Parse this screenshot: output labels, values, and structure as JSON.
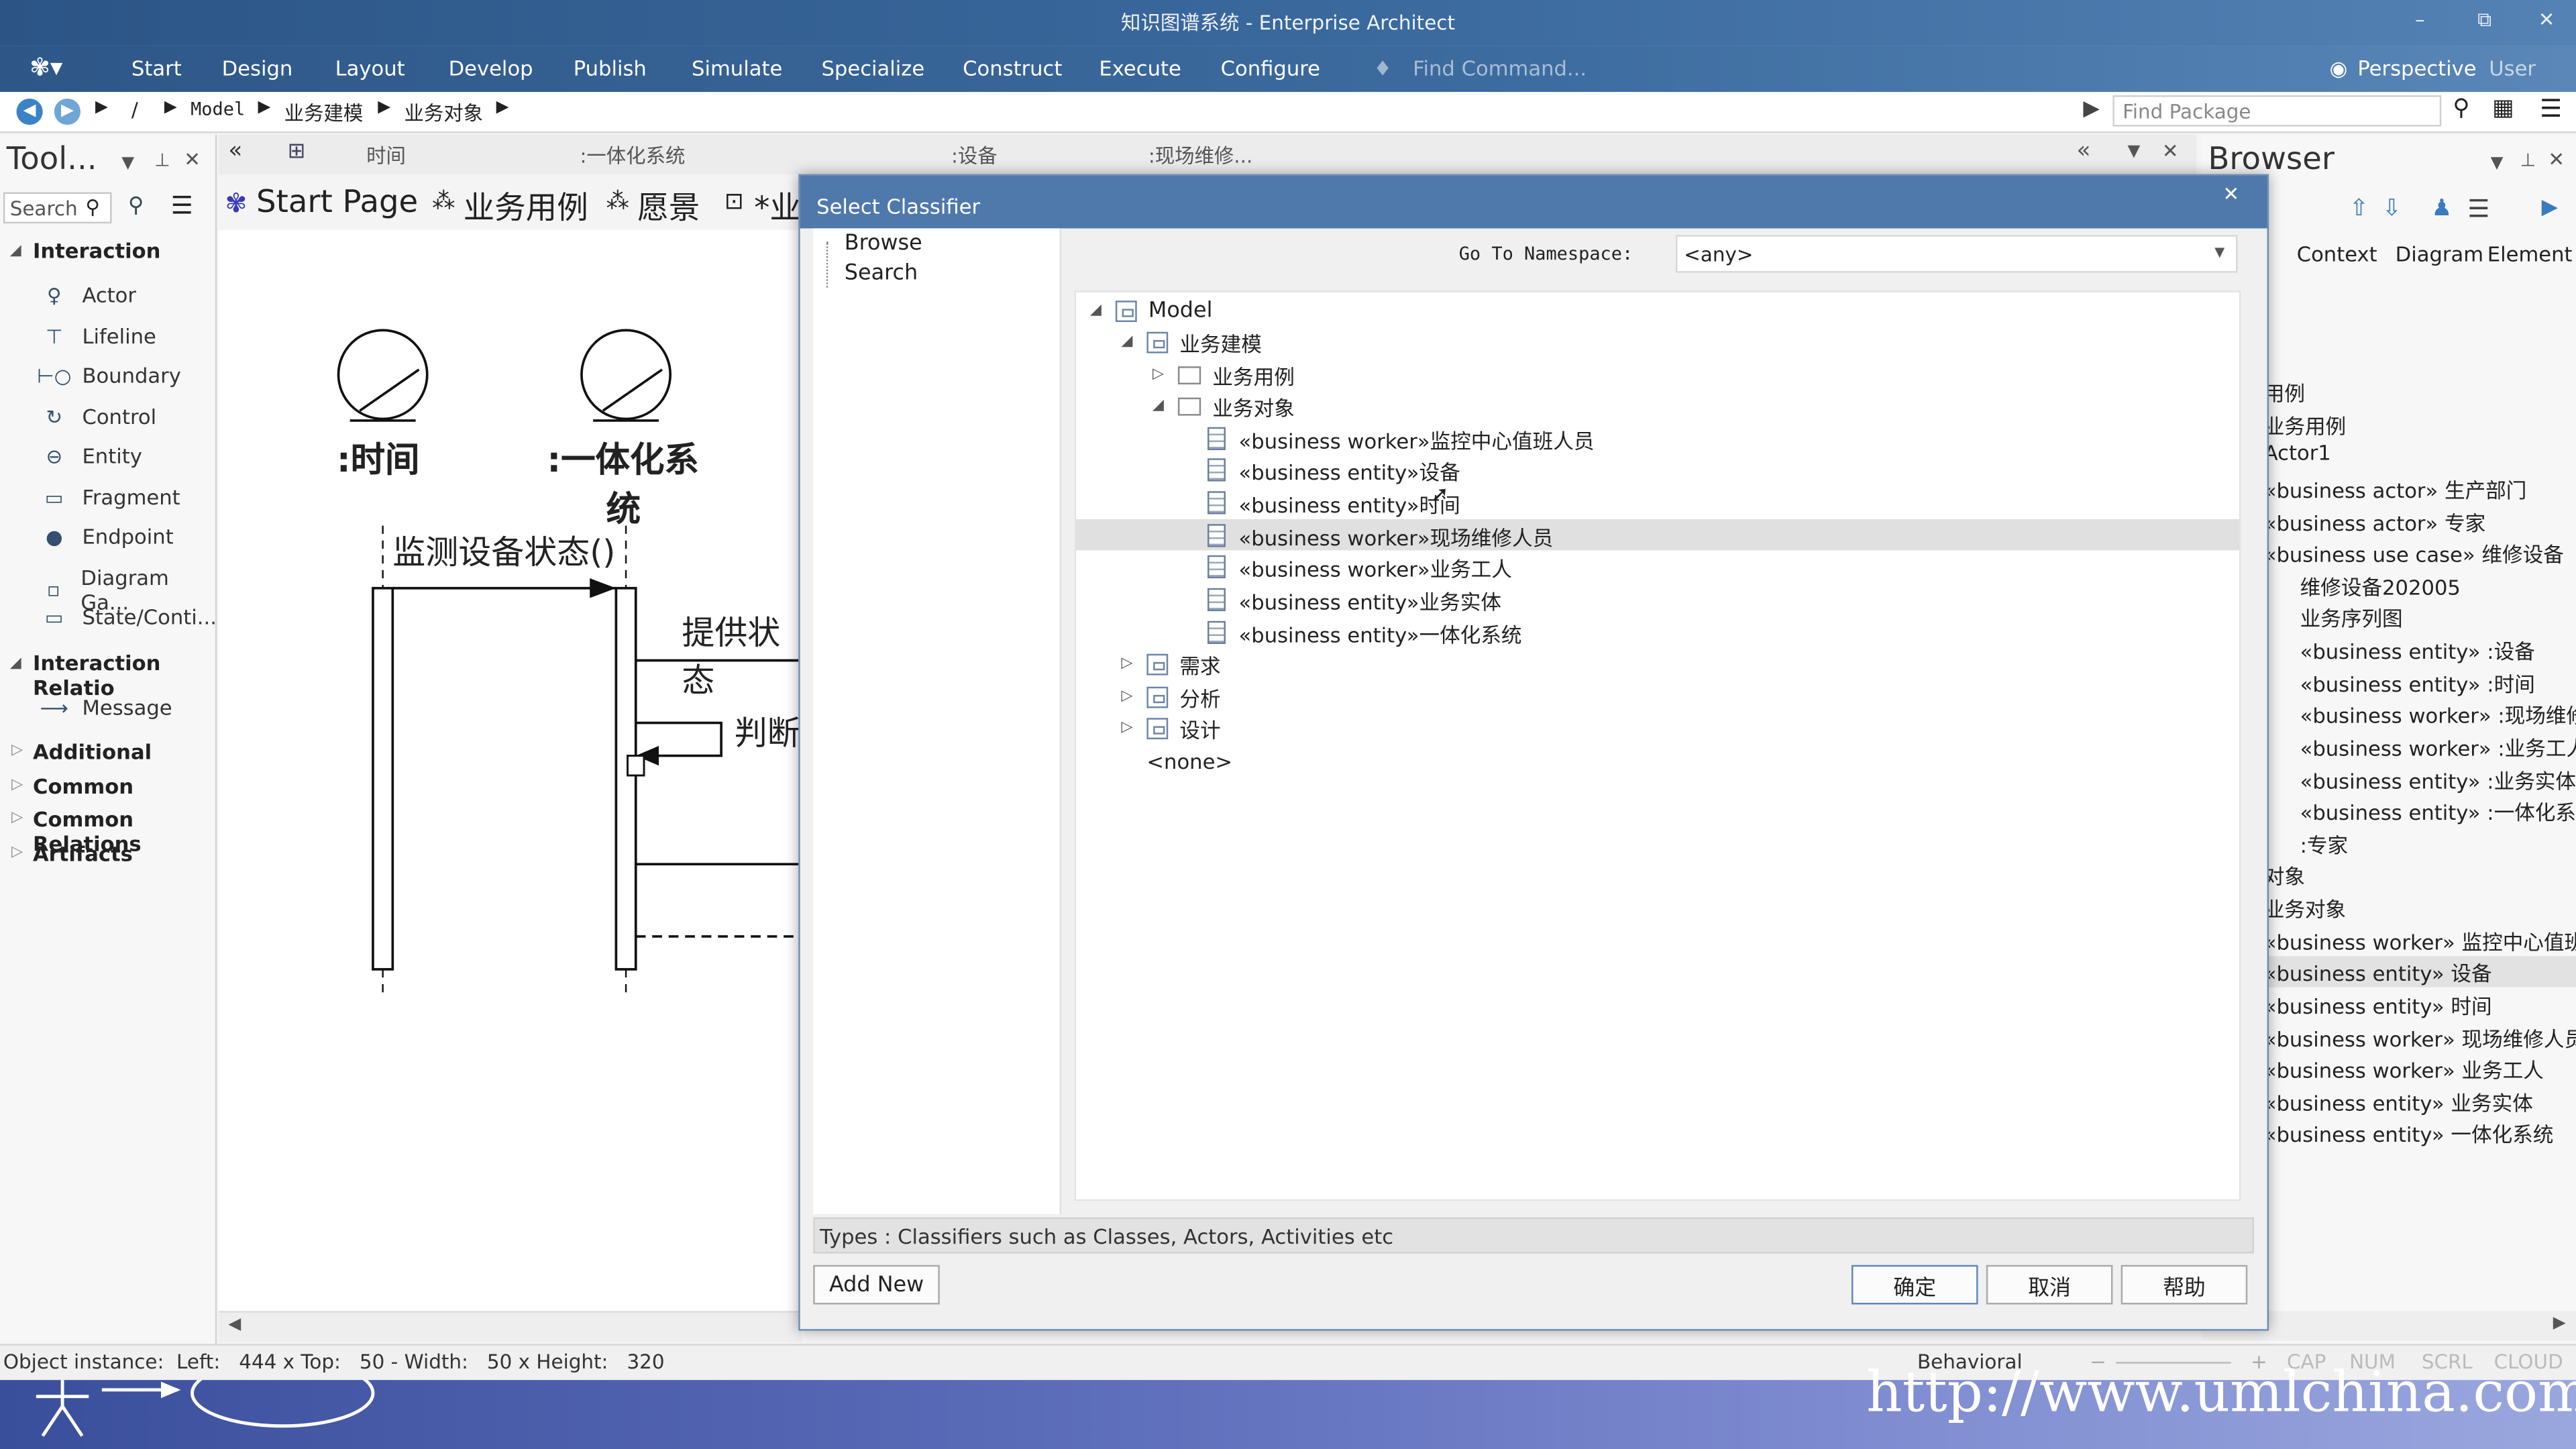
{
  "window": {
    "title": "知识图谱系统 - Enterprise Architect",
    "min": "–",
    "restore": "⧉",
    "close": "✕"
  },
  "menu": {
    "items": [
      "Start",
      "Design",
      "Layout",
      "Develop",
      "Publish",
      "Simulate",
      "Specialize",
      "Construct",
      "Execute",
      "Configure"
    ],
    "find_command": "Find Command...",
    "perspective": "Perspective",
    "user": "User"
  },
  "address": {
    "path": [
      "/",
      "Model",
      "业务建模",
      "业务对象"
    ],
    "find_package_placeholder": "Find Package"
  },
  "toolbox": {
    "title": "Tool...",
    "search_placeholder": "Search",
    "section_interaction": "Interaction",
    "items": [
      "Actor",
      "Lifeline",
      "Boundary",
      "Control",
      "Entity",
      "Fragment",
      "Endpoint",
      "Diagram Ga...",
      "State/Conti..."
    ],
    "section_relations": "Interaction Relatio",
    "relation_items": [
      "Message"
    ],
    "other_sections": [
      "Additional",
      "Common",
      "Common Relations",
      "Artifacts"
    ]
  },
  "diagram": {
    "header_tabs": [
      "时间",
      ":一体化系统",
      ":设备",
      ":现场维修..."
    ],
    "doc_tabs": [
      "Start Page",
      "业务用例",
      "愿景",
      "*业"
    ],
    "lifeline1": ":时间",
    "lifeline2_a": ":一体化系",
    "lifeline2_b": "统",
    "msg1": "监测设备状态()",
    "msg2": "提供状态",
    "msg3": "判断"
  },
  "status": {
    "left": "Object instance:  Left:   444 x Top:   50 - Width:   50 x Height:   320",
    "mode": "Behavioral",
    "flags": [
      "CAP",
      "NUM",
      "SCRL",
      "CLOUD"
    ]
  },
  "watermark": "http://www.umlchina.com",
  "browser": {
    "title": "Browser",
    "tabs": [
      "Context",
      "Diagram",
      "Element"
    ],
    "lines": [
      "用例",
      "业务用例",
      "Actor1",
      "«business actor» 生产部门",
      "«business actor» 专家",
      "«business use case» 维修设备",
      "维修设备202005",
      "业务序列图",
      "«business entity» :设备",
      "«business entity» :时间",
      "«business worker» :现场维修人",
      "«business worker» :业务工人",
      "«business entity» :业务实体",
      "«business entity» :一体化系统",
      ":专家",
      "对象",
      "业务对象",
      "«business worker» 监控中心值班人",
      "«business entity» 设备",
      "«business entity» 时间",
      "«business worker» 现场维修人员",
      "«business worker» 业务工人",
      "«business entity» 业务实体",
      "«business entity» 一体化系统"
    ]
  },
  "dialog": {
    "title": "Select Classifier",
    "close": "✕",
    "left_items": [
      "Browse",
      "Search"
    ],
    "namespace_label": "Go To Namespace:",
    "namespace_value": "<any>",
    "tree": {
      "root": "Model",
      "pkg": "业务建模",
      "folder1": "业务用例",
      "folder2": "业务对象",
      "classes": [
        "«business worker»监控中心值班人员",
        "«business entity»设备",
        "«business entity»时间",
        "«business worker»现场维修人员",
        "«business worker»业务工人",
        "«business entity»业务实体",
        "«business entity»一体化系统"
      ],
      "others": [
        "需求",
        "分析",
        "设计"
      ],
      "none": "<none>"
    },
    "types_text": "Types : Classifiers such as Classes, Actors, Activities etc",
    "add_new": "Add New",
    "ok": "确定",
    "cancel": "取消",
    "help": "帮助"
  }
}
